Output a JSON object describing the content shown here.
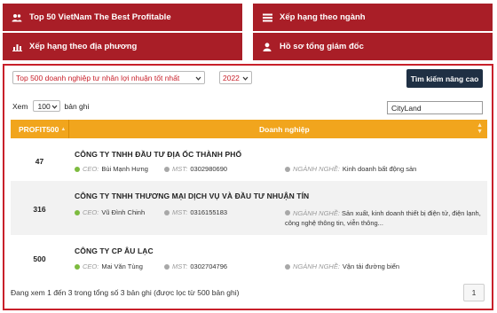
{
  "nav": {
    "top50": "Top 50 VietNam The Best Profitable",
    "by_industry": "Xếp hạng theo ngành",
    "by_region": "Xếp hạng theo địa phương",
    "ceo_profile": "Hồ sơ tổng giám đốc"
  },
  "filters": {
    "ranking_select": "Top 500 doanh nghiệp tư nhân lợi nhuận tốt nhất",
    "year_select": "2022",
    "advanced_search": "Tìm kiếm nâng cao"
  },
  "table_controls": {
    "show_label": "Xem",
    "page_size": "100",
    "records_label": "bản ghi",
    "search_value": "CityLand"
  },
  "table": {
    "col_profit": "PROFIT500",
    "col_company": "Doanh nghiệp",
    "labels": {
      "ceo": "CEO:",
      "mst": "MST:",
      "nganh_nghe": "NGÀNH NGHỀ:"
    },
    "rows": [
      {
        "rank": "47",
        "name": "CÔNG TY TNHH ĐẦU TƯ ĐỊA ỐC THÀNH PHỐ",
        "ceo": "Bùi Mạnh Hưng",
        "mst": "0302980690",
        "industry": "Kinh doanh bất động sản"
      },
      {
        "rank": "316",
        "name": "CÔNG TY TNHH THƯƠNG MẠI DỊCH VỤ VÀ ĐẦU TƯ NHUẬN TÍN",
        "ceo": "Vũ Đình Chinh",
        "mst": "0316155183",
        "industry": "Sản xuất, kinh doanh thiết bị điện tử, điện lạnh, công nghệ thông tin, viễn thông..."
      },
      {
        "rank": "500",
        "name": "CÔNG TY CP ÂU LẠC",
        "ceo": "Mai Văn Tùng",
        "mst": "0302704796",
        "industry": "Vận tải đường biển"
      }
    ]
  },
  "footer": {
    "info": "Đang xem 1 đến 3 trong tổng số 3 bản ghi (được lọc từ 500 bản ghi)",
    "page": "1"
  },
  "colors": {
    "brand_red": "#a91e27",
    "header_orange": "#f1a51d",
    "button_navy": "#1f3044",
    "ceo_dot": "#7dbb3f"
  }
}
